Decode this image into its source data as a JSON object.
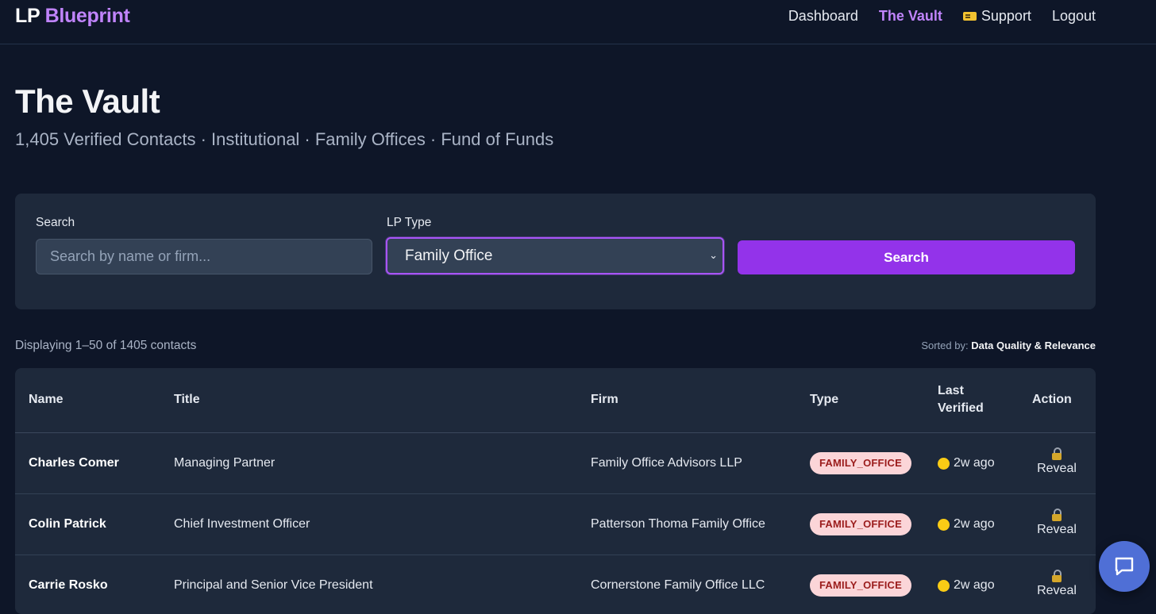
{
  "brand": {
    "prefix": "LP",
    "name": "Blueprint"
  },
  "nav": {
    "dashboard": "Dashboard",
    "vault": "The Vault",
    "support": "Support",
    "support_icon": "ticket-icon",
    "logout": "Logout"
  },
  "page": {
    "title": "The Vault",
    "subtitle": "1,405 Verified Contacts · Institutional · Family Offices · Fund of Funds"
  },
  "filters": {
    "search_label": "Search",
    "search_placeholder": "Search by name or firm...",
    "search_value": "",
    "type_label": "LP Type",
    "type_selected": "Family Office",
    "search_button": "Search"
  },
  "results": {
    "display_text": "Displaying 1–50 of 1405 contacts",
    "sorted_label": "Sorted by:",
    "sorted_value": "Data Quality & Relevance"
  },
  "table": {
    "headers": {
      "name": "Name",
      "title": "Title",
      "firm": "Firm",
      "type": "Type",
      "verified_line1": "Last",
      "verified_line2": "Verified",
      "action": "Action"
    },
    "rows": [
      {
        "name": "Charles Comer",
        "title": "Managing Partner",
        "firm": "Family Office Advisors LLP",
        "type": "FAMILY_OFFICE",
        "verified": "2w ago",
        "action": "Reveal"
      },
      {
        "name": "Colin Patrick",
        "title": "Chief Investment Officer",
        "firm": "Patterson Thoma Family Office",
        "type": "FAMILY_OFFICE",
        "verified": "2w ago",
        "action": "Reveal"
      },
      {
        "name": "Carrie Rosko",
        "title": "Principal and Senior Vice President",
        "firm": "Cornerstone Family Office LLC",
        "type": "FAMILY_OFFICE",
        "verified": "2w ago",
        "action": "Reveal"
      }
    ]
  },
  "colors": {
    "background": "#0e1628",
    "panel": "#1e293b",
    "accent": "#9333ea",
    "accent_text": "#c084fc",
    "badge_bg": "#fbd5d8",
    "badge_text": "#9b1c1c",
    "verified_dot": "#facc15"
  },
  "chat": {
    "icon": "chat-bubble-icon"
  }
}
